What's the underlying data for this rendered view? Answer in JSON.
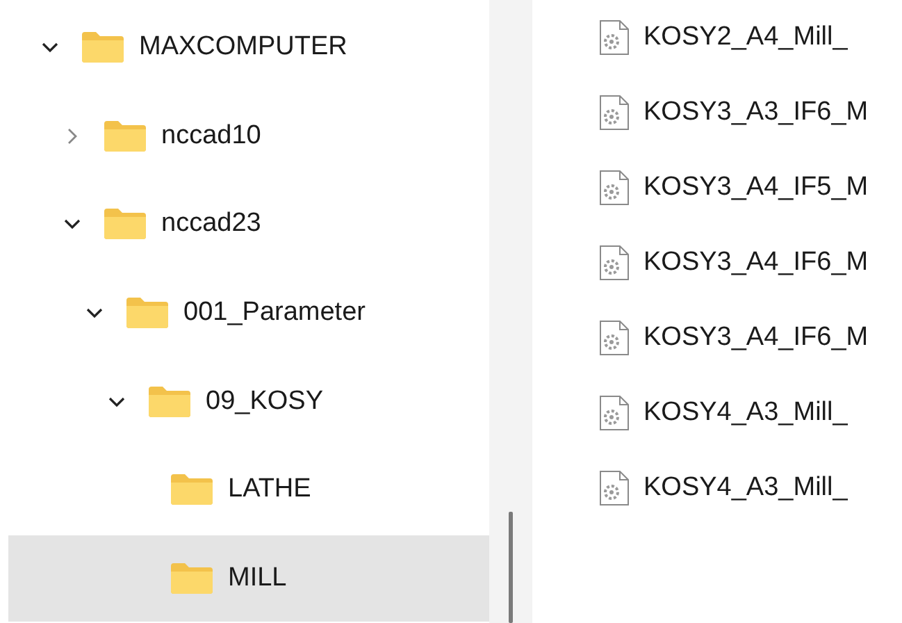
{
  "tree": [
    {
      "label": "MAXCOMPUTER",
      "kind": "branch",
      "expanded": true,
      "selected": false,
      "children": [
        {
          "label": "nccad10",
          "kind": "branch",
          "expanded": false,
          "selected": false
        },
        {
          "label": "nccad23",
          "kind": "branch",
          "expanded": true,
          "selected": false,
          "children": [
            {
              "label": "001_Parameter",
              "kind": "branch",
              "expanded": true,
              "selected": false,
              "children": [
                {
                  "label": "09_KOSY",
                  "kind": "branch",
                  "expanded": true,
                  "selected": false,
                  "children": [
                    {
                      "label": "LATHE",
                      "kind": "leaf",
                      "selected": false
                    },
                    {
                      "label": "MILL",
                      "kind": "leaf",
                      "selected": true
                    }
                  ]
                }
              ]
            }
          ]
        }
      ]
    }
  ],
  "files": [
    {
      "name": "KOSY2_A4_Mill_"
    },
    {
      "name": "KOSY3_A3_IF6_M"
    },
    {
      "name": "KOSY3_A4_IF5_M"
    },
    {
      "name": "KOSY3_A4_IF6_M"
    },
    {
      "name": "KOSY3_A4_IF6_M"
    },
    {
      "name": "KOSY4_A3_Mill_"
    },
    {
      "name": "KOSY4_A3_Mill_"
    }
  ]
}
